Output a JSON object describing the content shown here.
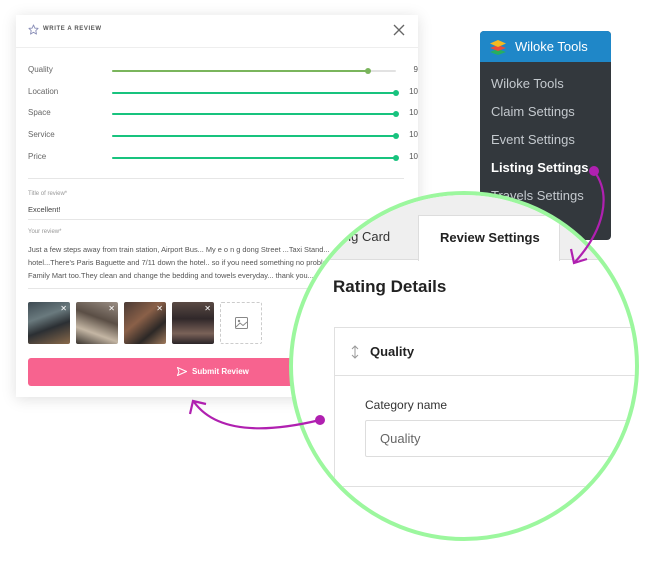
{
  "review_modal": {
    "title": "WRITE A REVIEW",
    "ratings": [
      {
        "label": "Quality",
        "value": 9,
        "max": 10
      },
      {
        "label": "Location",
        "value": 10,
        "max": 10
      },
      {
        "label": "Space",
        "value": 10,
        "max": 10
      },
      {
        "label": "Service",
        "value": 10,
        "max": 10
      },
      {
        "label": "Price",
        "value": 10,
        "max": 10
      }
    ],
    "title_field": {
      "label": "Title of review*",
      "value": "Excellent!"
    },
    "review_field": {
      "label": "Your review*",
      "lines": [
        "Just a few steps away from train station, Airport Bus... My e o n g dong Street ...Taxi Stand...",
        "hotel...There's Paris Baguette and 7/11 down the hotel.. so if you need something no problem...",
        "Family Mart too.They clean and change the bedding and towels everyday... thank you..."
      ]
    },
    "photos": [
      {
        "remove": "✕"
      },
      {
        "remove": "✕"
      },
      {
        "remove": "✕"
      },
      {
        "remove": "✕"
      }
    ],
    "submit_label": "Submit Review"
  },
  "wp_menu": {
    "brand": "Wiloke Tools",
    "items": [
      {
        "label": "Wiloke Tools",
        "active": false
      },
      {
        "label": "Claim Settings",
        "active": false
      },
      {
        "label": "Event Settings",
        "active": false
      },
      {
        "label": "Listing Settings",
        "active": true
      },
      {
        "label": "Travels Settings",
        "active": false
      }
    ]
  },
  "magnifier": {
    "tabs": [
      {
        "label": "ing Card",
        "active": false
      },
      {
        "label": "Review Settings",
        "active": true
      }
    ],
    "section_title": "Rating Details",
    "panel_title": "Quality",
    "category_label": "Category name",
    "category_value": "Quality"
  },
  "colors": {
    "accent_pink": "#f7638f",
    "slider_green": "#18c37e",
    "slider_quality": "#7ab55c",
    "wp_blue": "#1f87c8",
    "wp_dark": "#33383d",
    "ring_green": "#9cf79e",
    "arrow_purple": "#b020b0"
  }
}
